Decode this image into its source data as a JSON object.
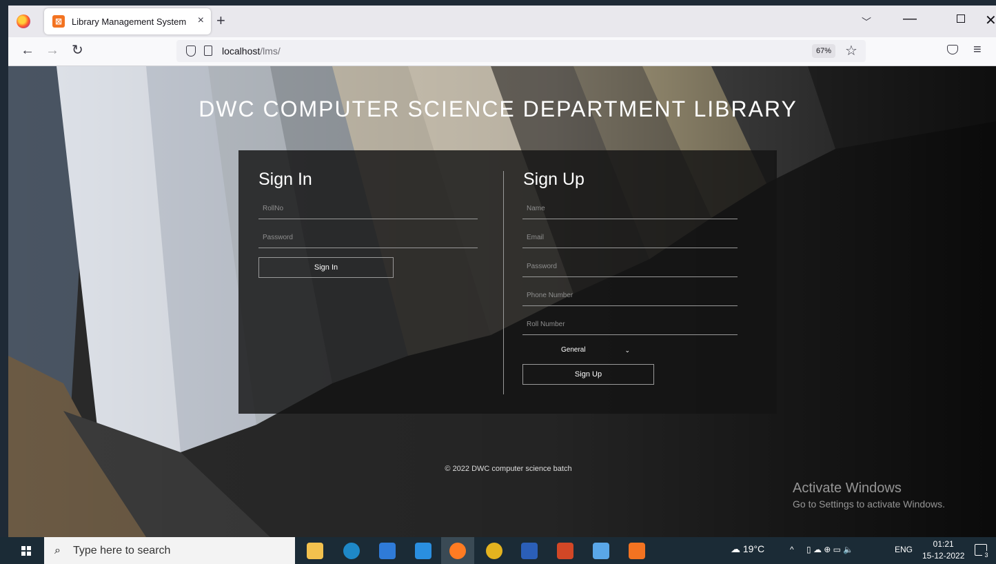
{
  "browser": {
    "tab_title": "Library Management System",
    "tab_close": "×",
    "new_tab": "+",
    "url_host": "localhost",
    "url_path": "/lms/",
    "zoom": "67%"
  },
  "page": {
    "title": "DWC COMPUTER SCIENCE DEPARTMENT LIBRARY",
    "signin": {
      "heading": "Sign In",
      "rollno_placeholder": "RollNo",
      "password_placeholder": "Password",
      "button": "Sign In"
    },
    "signup": {
      "heading": "Sign Up",
      "name_placeholder": "Name",
      "email_placeholder": "Email",
      "password_placeholder": "Password",
      "phone_placeholder": "Phone Number",
      "roll_placeholder": "Roll Number",
      "category_selected": "General",
      "button": "Sign Up"
    },
    "footer": "© 2022 DWC computer science batch"
  },
  "watermark": {
    "title": "Activate Windows",
    "subtitle": "Go to Settings to activate Windows."
  },
  "taskbar": {
    "search_placeholder": "Type here to search",
    "weather": "19°C",
    "language": "ENG",
    "time": "01:21",
    "date": "15-12-2022",
    "notification_count": "3"
  },
  "colors": {
    "accent": "#ffffff",
    "panel": "#141414",
    "xampp": "#f37321"
  }
}
